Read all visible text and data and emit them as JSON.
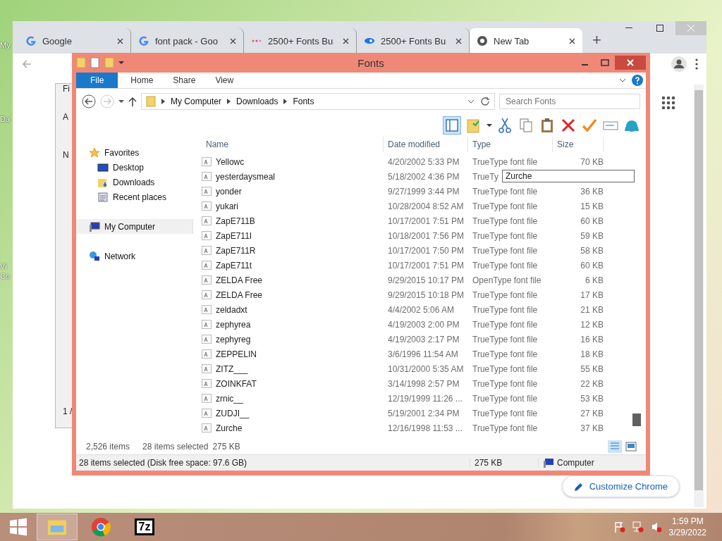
{
  "desktop_icons": [
    {
      "label": "My"
    },
    {
      "label": "Da"
    },
    {
      "label": "Vi"
    },
    {
      "label": "Co"
    }
  ],
  "browser": {
    "tabs": [
      {
        "title": "Google",
        "kind": "google",
        "selected": false
      },
      {
        "title": "font pack - Goo",
        "kind": "google",
        "selected": false
      },
      {
        "title": "2500+ Fonts Bu",
        "kind": "dots",
        "selected": false
      },
      {
        "title": "2500+ Fonts Bu",
        "kind": "swirl",
        "selected": false
      },
      {
        "title": "New Tab",
        "kind": "chrome",
        "selected": true
      }
    ],
    "new_tab": "+",
    "customize_button": "Customize Chrome"
  },
  "back_window": {
    "texts": [
      "Fi",
      "A",
      "N",
      "1 /"
    ]
  },
  "explorer": {
    "title": "Fonts",
    "ribbon_tabs": [
      {
        "label": "File",
        "kind": "file"
      },
      {
        "label": "Home",
        "kind": "tab"
      },
      {
        "label": "Share",
        "kind": "tab"
      },
      {
        "label": "View",
        "kind": "tab"
      }
    ],
    "address": [
      "My Computer",
      "Downloads",
      "Fonts"
    ],
    "search": {
      "placeholder": "Search Fonts"
    },
    "nav": [
      {
        "label": "Favorites",
        "kind": "star",
        "children": [
          {
            "label": "Desktop",
            "kind": "desktop",
            "selected": false
          },
          {
            "label": "Downloads",
            "kind": "downloads",
            "selected": false
          },
          {
            "label": "Recent places",
            "kind": "recent",
            "selected": false
          }
        ],
        "selected": false
      },
      {
        "label": "My Computer",
        "kind": "computer",
        "selected": true
      },
      {
        "label": "Network",
        "kind": "network",
        "selected": false
      }
    ],
    "columns": [
      "Name",
      "Date modified",
      "Type",
      "Size"
    ],
    "rows": [
      {
        "name": "Yellowc",
        "date": "4/20/2002 5:33 PM",
        "type": "TrueType font file",
        "size": "70 KB"
      },
      {
        "name": "yesterdaysmeal",
        "date": "5/18/2002 4:36 PM",
        "type": "TrueTy"
      },
      {
        "name": "yonder",
        "date": "9/27/1999 3:44 PM",
        "type": "TrueType font file",
        "size": "36 KB"
      },
      {
        "name": "yukari",
        "date": "10/28/2004 8:52 AM",
        "type": "TrueType font file",
        "size": "15 KB"
      },
      {
        "name": "ZapE711B",
        "date": "10/17/2001 7:51 PM",
        "type": "TrueType font file",
        "size": "60 KB"
      },
      {
        "name": "ZapE711I",
        "date": "10/18/2001 7:56 PM",
        "type": "TrueType font file",
        "size": "59 KB"
      },
      {
        "name": "ZapE711R",
        "date": "10/17/2001 7:50 PM",
        "type": "TrueType font file",
        "size": "58 KB"
      },
      {
        "name": "ZapE711t",
        "date": "10/17/2001 7:51 PM",
        "type": "TrueType font file",
        "size": "60 KB"
      },
      {
        "name": "ZELDA Free",
        "date": "9/29/2015 10:17 PM",
        "type": "OpenType font file",
        "size": "6 KB"
      },
      {
        "name": "ZELDA Free",
        "date": "9/29/2015 10:18 PM",
        "type": "TrueType font file",
        "size": "17 KB"
      },
      {
        "name": "zeldadxt",
        "date": "4/4/2002 5:06 AM",
        "type": "TrueType font file",
        "size": "21 KB"
      },
      {
        "name": "zephyrea",
        "date": "4/19/2003 2:00 PM",
        "type": "TrueType font file",
        "size": "12 KB"
      },
      {
        "name": "zephyreg",
        "date": "4/19/2003 2:17 PM",
        "type": "TrueType font file",
        "size": "16 KB"
      },
      {
        "name": "ZEPPELIN",
        "date": "3/6/1996 11:54 AM",
        "type": "TrueType font file",
        "size": "18 KB"
      },
      {
        "name": "ZITZ___",
        "date": "10/31/2000 5:35 AM",
        "type": "TrueType font file",
        "size": "55 KB"
      },
      {
        "name": "ZOINKFAT",
        "date": "3/14/1998 2:57 PM",
        "type": "TrueType font file",
        "size": "22 KB"
      },
      {
        "name": "zrnic__",
        "date": "12/19/1999 11:26 ...",
        "type": "TrueType font file",
        "size": "53 KB"
      },
      {
        "name": "ZUDJI__",
        "date": "5/19/2001 2:34 PM",
        "type": "TrueType font file",
        "size": "27 KB"
      },
      {
        "name": "Zurche",
        "date": "12/16/1998 11:53 ...",
        "type": "TrueType font file",
        "size": "37 KB"
      }
    ],
    "rename_box": "Zurche",
    "details": {
      "count": "2,526 items",
      "selected": "28 items selected",
      "size": "275 KB"
    },
    "status_bar": {
      "text": "28 items selected (Disk free space: 97.6 GB)",
      "size": "275 KB",
      "location": "Computer"
    }
  },
  "taskbar": {
    "apps": [
      {
        "kind": "explorer",
        "selected": true
      },
      {
        "kind": "chrome",
        "selected": false
      },
      {
        "kind": "sevenzip",
        "selected": false,
        "label": "7z"
      }
    ],
    "time": "1:59 PM",
    "date": "3/29/2022"
  }
}
